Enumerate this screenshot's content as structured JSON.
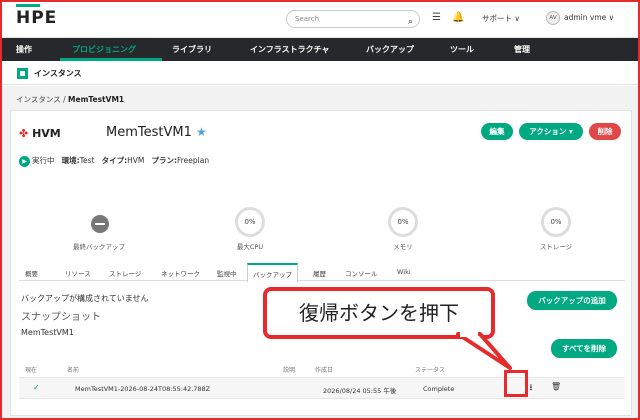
{
  "header": {
    "logo": "HPE",
    "search_placeholder": "Search",
    "support": "サポート ∨",
    "avatar": "AV",
    "user": "admin vme ∨"
  },
  "nav": [
    "操作",
    "プロビジョニング",
    "ライブラリ",
    "インフラストラクチャ",
    "バックアップ",
    "ツール",
    "管理"
  ],
  "subheader": {
    "title": "インスタンス"
  },
  "breadcrumb": {
    "root": "インスタンス",
    "sep": "/",
    "current": "MemTestVM1"
  },
  "instance": {
    "platform": "HVM",
    "name": "MemTestVM1",
    "state": "実行中",
    "env_label": "環境:",
    "env_value": "Test",
    "type_label": "タイプ:",
    "type_value": "HVM",
    "plan_label": "プラン:",
    "plan_value": "Freeplan"
  },
  "actions": {
    "edit": "編集",
    "action": "アクション ▾",
    "delete": "削除"
  },
  "stats": [
    {
      "label": "最終バックアップ",
      "value": ""
    },
    {
      "label": "最大CPU",
      "value": "0%"
    },
    {
      "label": "メモリ",
      "value": "0%"
    },
    {
      "label": "ストレージ",
      "value": "0%"
    }
  ],
  "tabs": [
    "概要",
    "リソース",
    "ストレージ",
    "ネットワーク",
    "監視中",
    "バックアップ",
    "履歴",
    "コンソール",
    "Wiki"
  ],
  "active_tab": "バックアップ",
  "backup": {
    "not_configured": "バックアップが構成されていません",
    "add_button": "バックアップの追加",
    "snapshot_heading": "スナップショット",
    "snapshot_instance": "MemTestVM1",
    "delete_all_button": "すべてを削除",
    "columns": [
      "現在",
      "名前",
      "説明",
      "作成日",
      "ステータス"
    ],
    "rows": [
      {
        "current": "✓",
        "name": "MemTestVM1-2026-08-24T08:55:42.788Z",
        "description": "",
        "created": "2026/08/24 05:55 午後",
        "status": "Complete"
      }
    ]
  },
  "callout": {
    "text": "復帰ボタンを押下"
  },
  "colors": {
    "accent": "#01a982",
    "danger": "#e04848",
    "nav_bg": "#26282b",
    "highlight": "#e52b2b"
  }
}
